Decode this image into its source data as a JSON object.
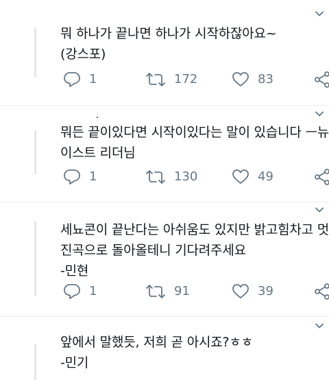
{
  "tweets": [
    {
      "lines": [
        "뭐 하나가 끝나면 하나가 시작하잖아요~",
        "(강스포)"
      ],
      "replies": "1",
      "retweets": "172",
      "likes": "83"
    },
    {
      "lines": [
        "뭐든 끝이있다면 시작이있다는 말이 있습니다 ㅡ뉴",
        "이스트 리더님"
      ],
      "replies": "1",
      "retweets": "130",
      "likes": "49"
    },
    {
      "lines": [
        "세뇨콘이 끝난다는 아쉬움도 있지만 밝고힘차고 멋",
        "진곡으로 돌아올테니 기다려주세요",
        "-민현"
      ],
      "replies": "1",
      "retweets": "91",
      "likes": "39"
    },
    {
      "lines": [
        "앞에서 말했듯, 저희 곧 아시죠?ㅎㅎ",
        "-민기"
      ]
    }
  ],
  "icons": {
    "more": "chevron-down-icon",
    "reply": "reply-icon",
    "retweet": "retweet-icon",
    "like": "heart-icon",
    "share": "share-icon"
  },
  "colors": {
    "text": "#14171a",
    "icon": "#657786",
    "thread_line": "#e4e6e8"
  }
}
